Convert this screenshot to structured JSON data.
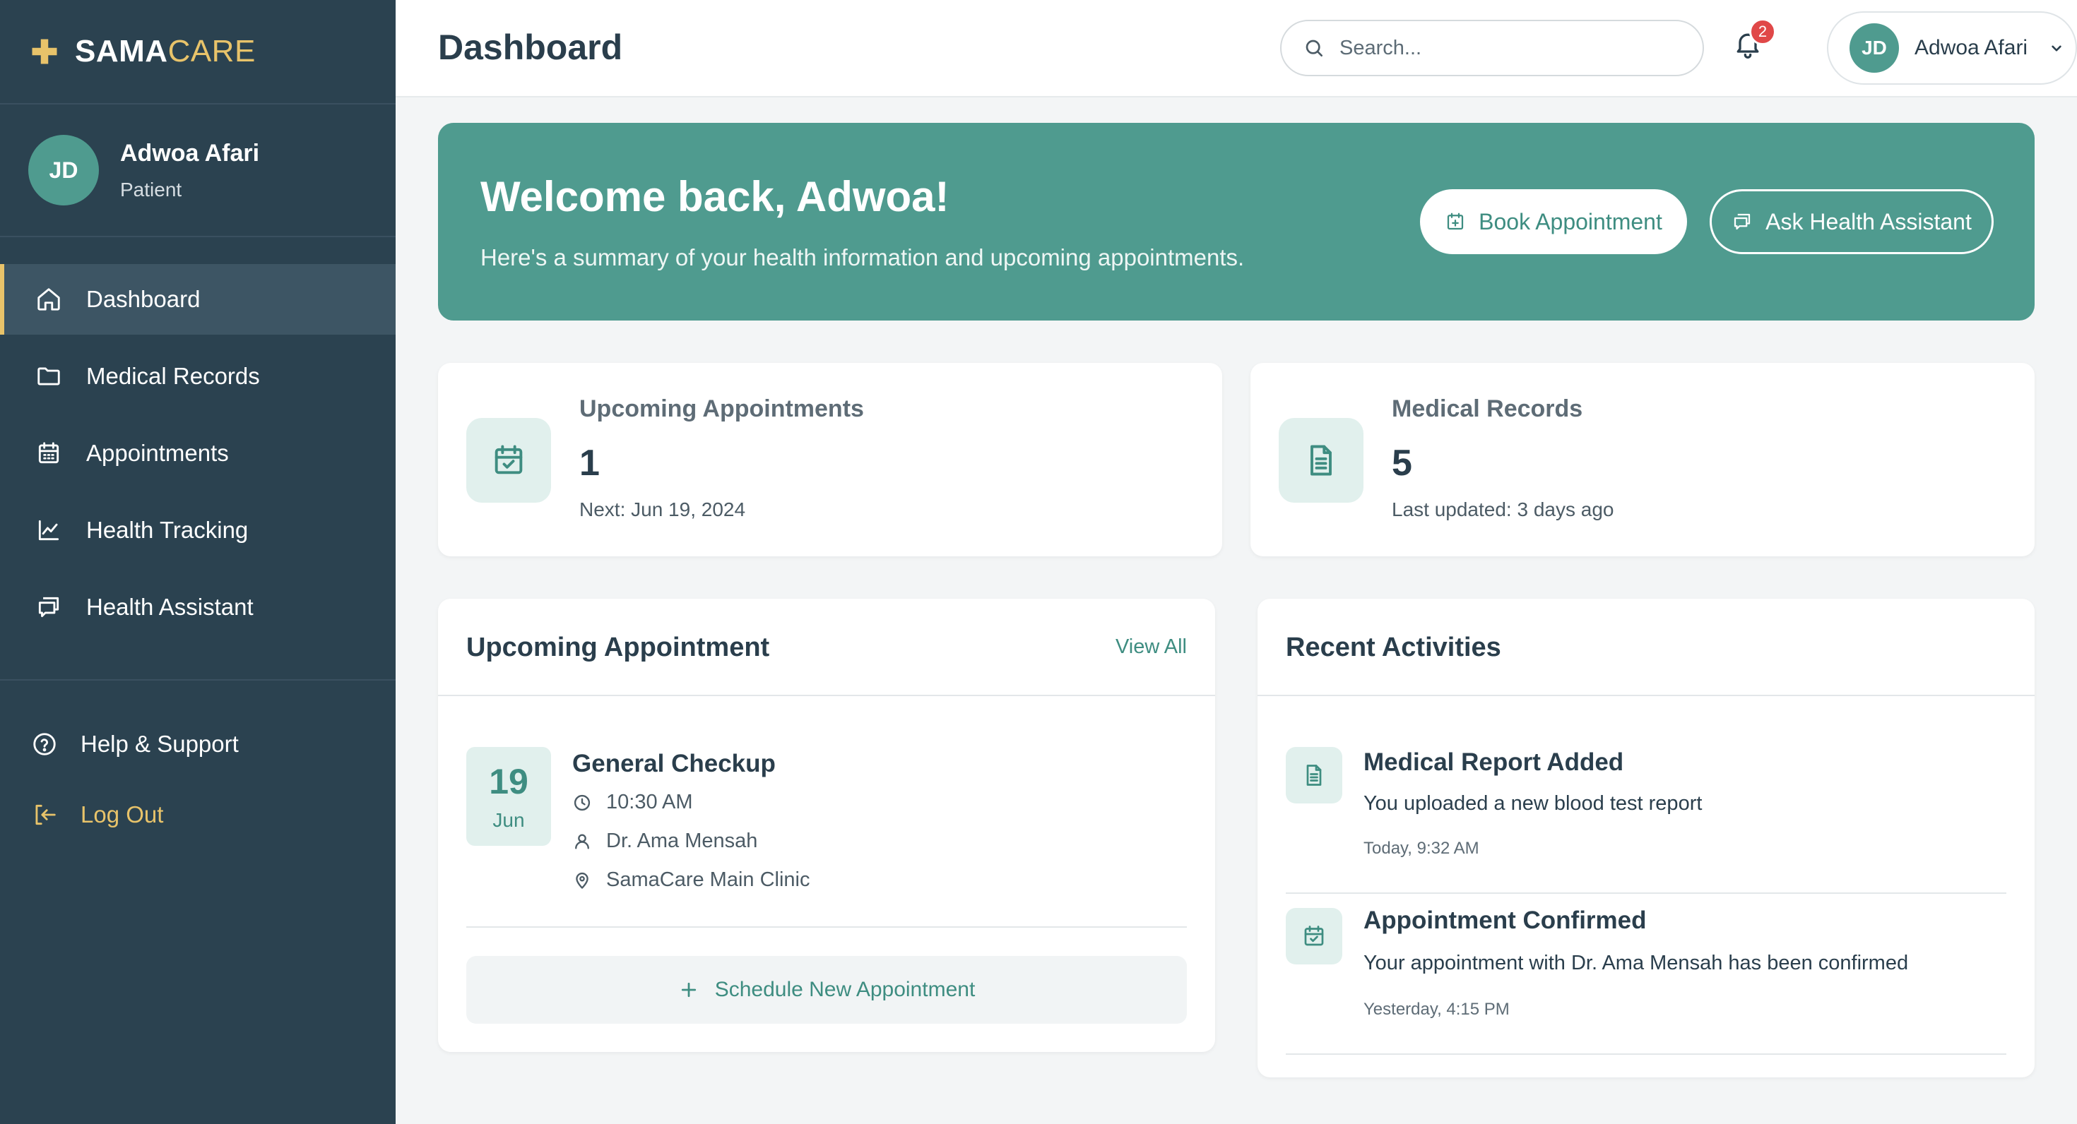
{
  "brand": {
    "part1": "SAMA",
    "part2": "CARE",
    "accent_color": "#e8c36a",
    "icon": "plus-icon"
  },
  "sidebar": {
    "profile": {
      "initials": "JD",
      "name": "Adwoa Afari",
      "role": "Patient"
    },
    "items": [
      {
        "label": "Dashboard",
        "icon": "home-icon",
        "active": true
      },
      {
        "label": "Medical Records",
        "icon": "folder-icon",
        "active": false
      },
      {
        "label": "Appointments",
        "icon": "calendar-icon",
        "active": false
      },
      {
        "label": "Health Tracking",
        "icon": "line-chart-icon",
        "active": false
      },
      {
        "label": "Health Assistant",
        "icon": "chat-icon",
        "active": false
      }
    ],
    "help": {
      "label": "Help & Support",
      "icon": "help-circle-icon"
    },
    "logout": {
      "label": "Log Out",
      "icon": "logout-icon"
    }
  },
  "header": {
    "title": "Dashboard",
    "search": {
      "placeholder": "Search...",
      "value": ""
    },
    "notifications": {
      "count": "2"
    },
    "user": {
      "initials": "JD",
      "name": "Adwoa Afari"
    }
  },
  "welcome": {
    "title": "Welcome back, Adwoa!",
    "subtitle": "Here's a summary of your health information and upcoming appointments.",
    "book_label": "Book Appointment",
    "ask_label": "Ask Health Assistant"
  },
  "stats": {
    "appointments": {
      "label": "Upcoming Appointments",
      "value": "1",
      "sub": "Next: Jun 19, 2024"
    },
    "records": {
      "label": "Medical Records",
      "value": "5",
      "sub": "Last updated: 3 days ago"
    }
  },
  "upcoming": {
    "title": "Upcoming Appointment",
    "view_all": "View All",
    "appointment": {
      "day": "19",
      "month": "Jun",
      "title": "General Checkup",
      "time": "10:30 AM",
      "doctor": "Dr. Ama Mensah",
      "location": "SamaCare Main Clinic"
    },
    "schedule_label": "Schedule New Appointment"
  },
  "activities": {
    "title": "Recent Activities",
    "items": [
      {
        "icon": "document-icon",
        "title": "Medical Report Added",
        "desc": "You uploaded a new blood test report",
        "time": "Today, 9:32 AM"
      },
      {
        "icon": "calendar-check-icon",
        "title": "Appointment Confirmed",
        "desc": "Your appointment with Dr. Ama Mensah has been confirmed",
        "time": "Yesterday, 4:15 PM"
      }
    ]
  },
  "colors": {
    "sidebar_bg": "#2b4250",
    "primary": "#4f9b8f",
    "accent": "#e8c36a",
    "badge": "#e04848"
  }
}
